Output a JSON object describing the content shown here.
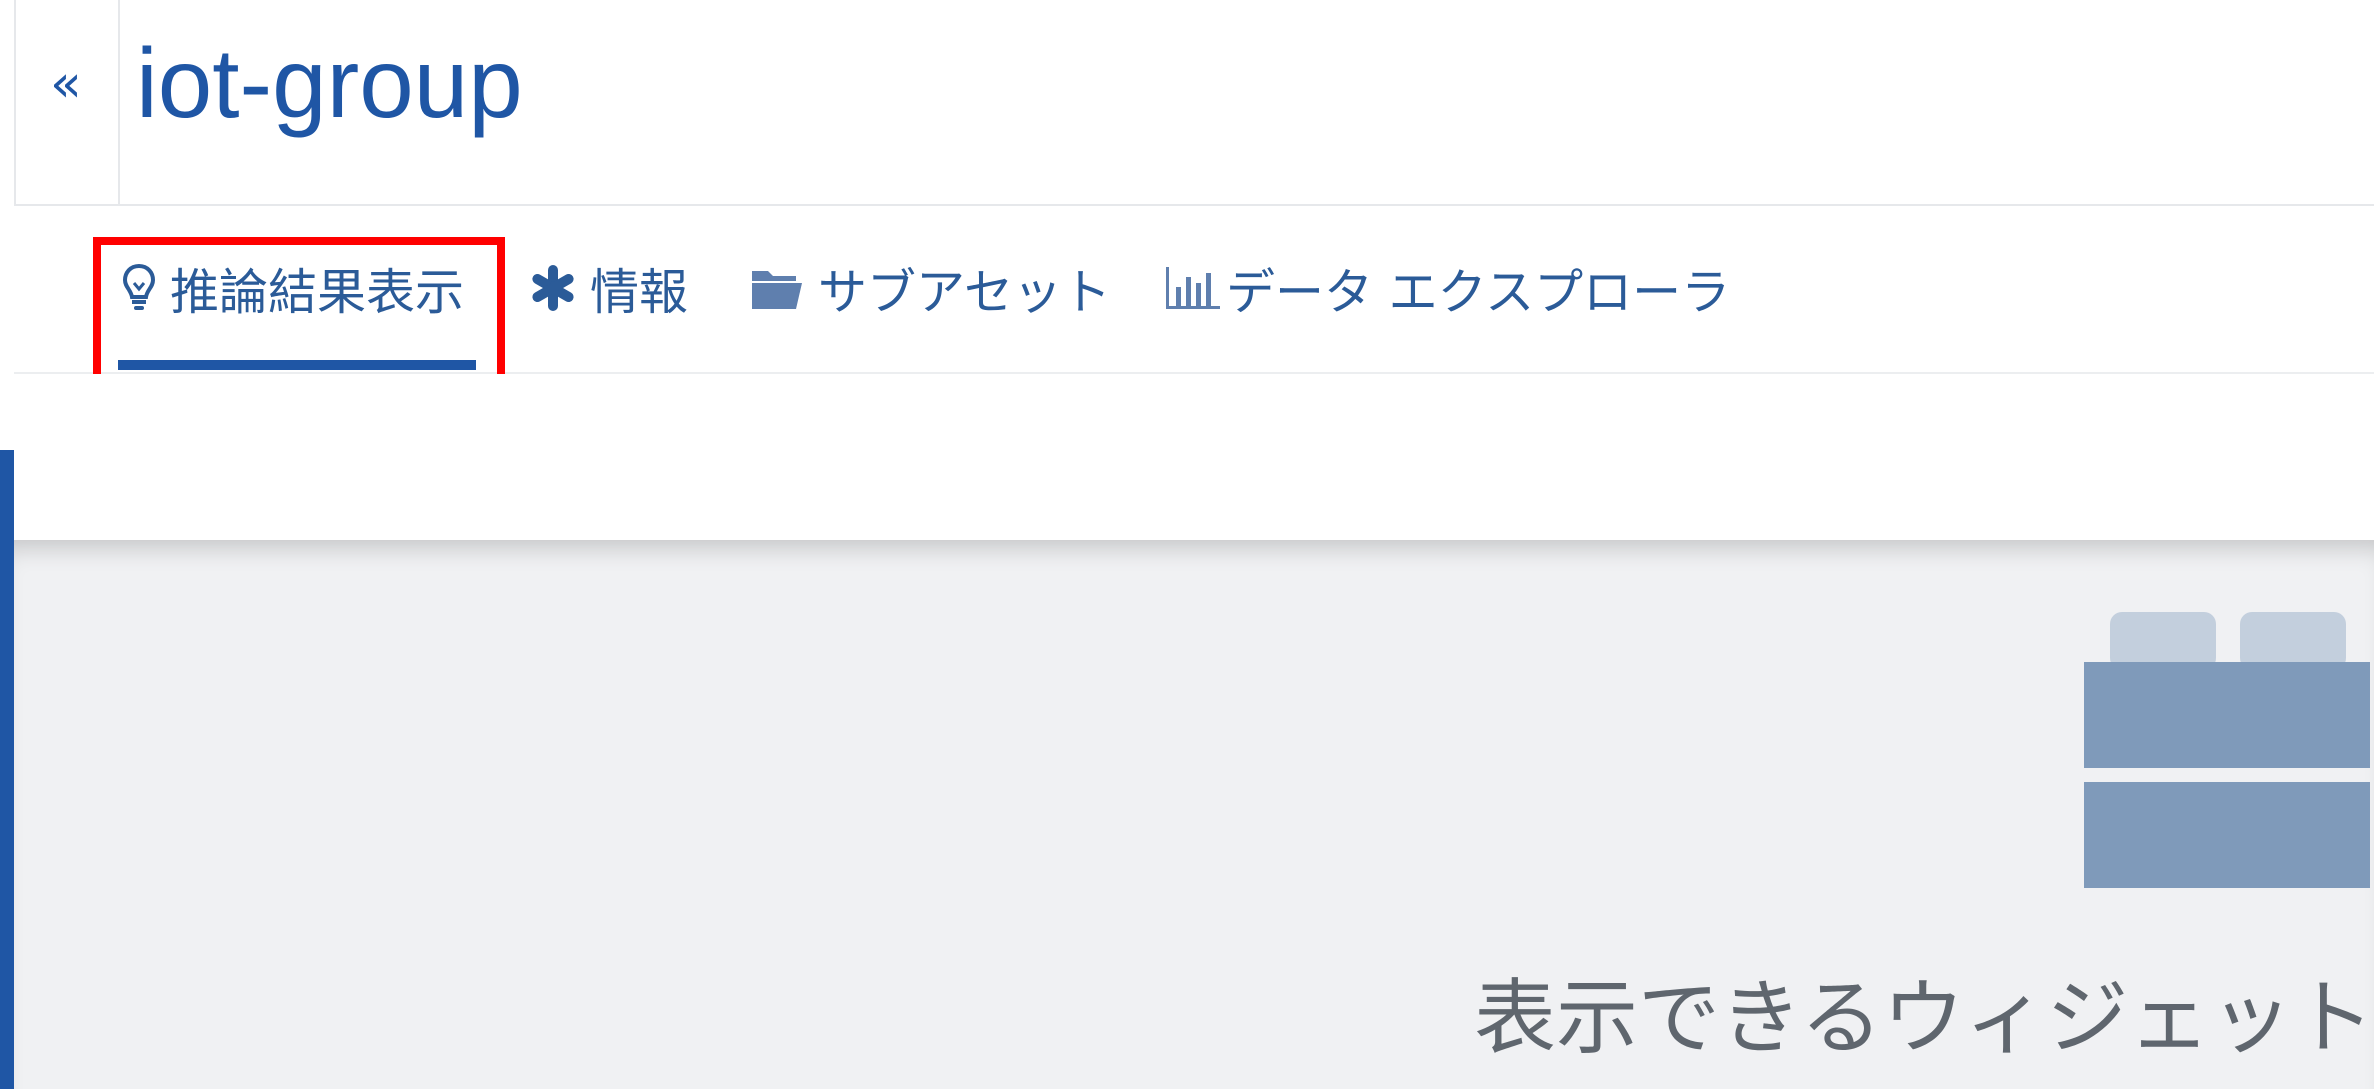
{
  "header": {
    "collapse_label": "«",
    "title": "iot-group"
  },
  "tabs": [
    {
      "label": "推論結果表示",
      "icon": "lightbulb-icon",
      "active": true
    },
    {
      "label": "情報",
      "icon": "asterisk-icon",
      "active": false
    },
    {
      "label": "サブアセット",
      "icon": "folder-icon",
      "active": false
    },
    {
      "label": "データ エクスプローラ",
      "icon": "bar-chart-icon",
      "active": false
    }
  ],
  "empty_state": {
    "icon": "widget-blocks-icon",
    "title": "表示できるウィジェット"
  },
  "colors": {
    "accent": "#1f56a5",
    "tab_text": "#2b5b98",
    "highlight": "#ff0000",
    "content_bg": "#f0f1f3",
    "illustration_dark": "#7f9aba",
    "illustration_light": "#c3cfdd"
  }
}
